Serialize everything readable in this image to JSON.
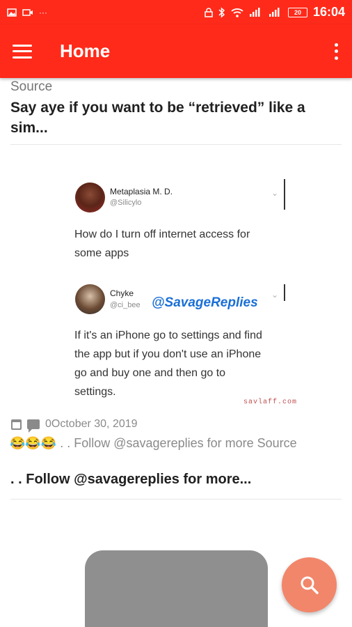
{
  "status_bar": {
    "left_icons": [
      "image-icon",
      "video-icon",
      "more-icon"
    ],
    "right_icons": [
      "lock-icon",
      "bluetooth-icon",
      "wifi-icon",
      "signal-icon",
      "signal-icon",
      "battery-icon"
    ],
    "battery": "20",
    "time": "16:04",
    "left_more": "···"
  },
  "app_bar": {
    "title": "Home",
    "color": "#ff2a1a"
  },
  "post1": {
    "source": "Source",
    "title_line1": "Say aye if you want to be “retrieved” like a",
    "title_line2": "sim..."
  },
  "tweet": {
    "author1": {
      "name": "Metaplasia M. D.",
      "handle": "@Silicylo"
    },
    "text1_line1": "How do I turn off internet access for",
    "text1_line2": "some apps",
    "author2": {
      "name": "Chyke",
      "handle": "@ci_bee"
    },
    "overlay": "@SavageReplies",
    "text2_line1": "If it's an iPhone go to settings and find",
    "text2_line2": "the app but if you don't use an iPhone",
    "text2_line3": "go and buy one and then go to",
    "text2_line4": "settings.",
    "watermark": "savlaff.com"
  },
  "post2": {
    "date": "0October 30, 2019",
    "excerpt": "😂😂😂 . . Follow @savagereplies for more Source",
    "title": ". . Follow @savagereplies for more..."
  },
  "fab": {
    "icon": "search-icon",
    "color": "#f2866a"
  }
}
